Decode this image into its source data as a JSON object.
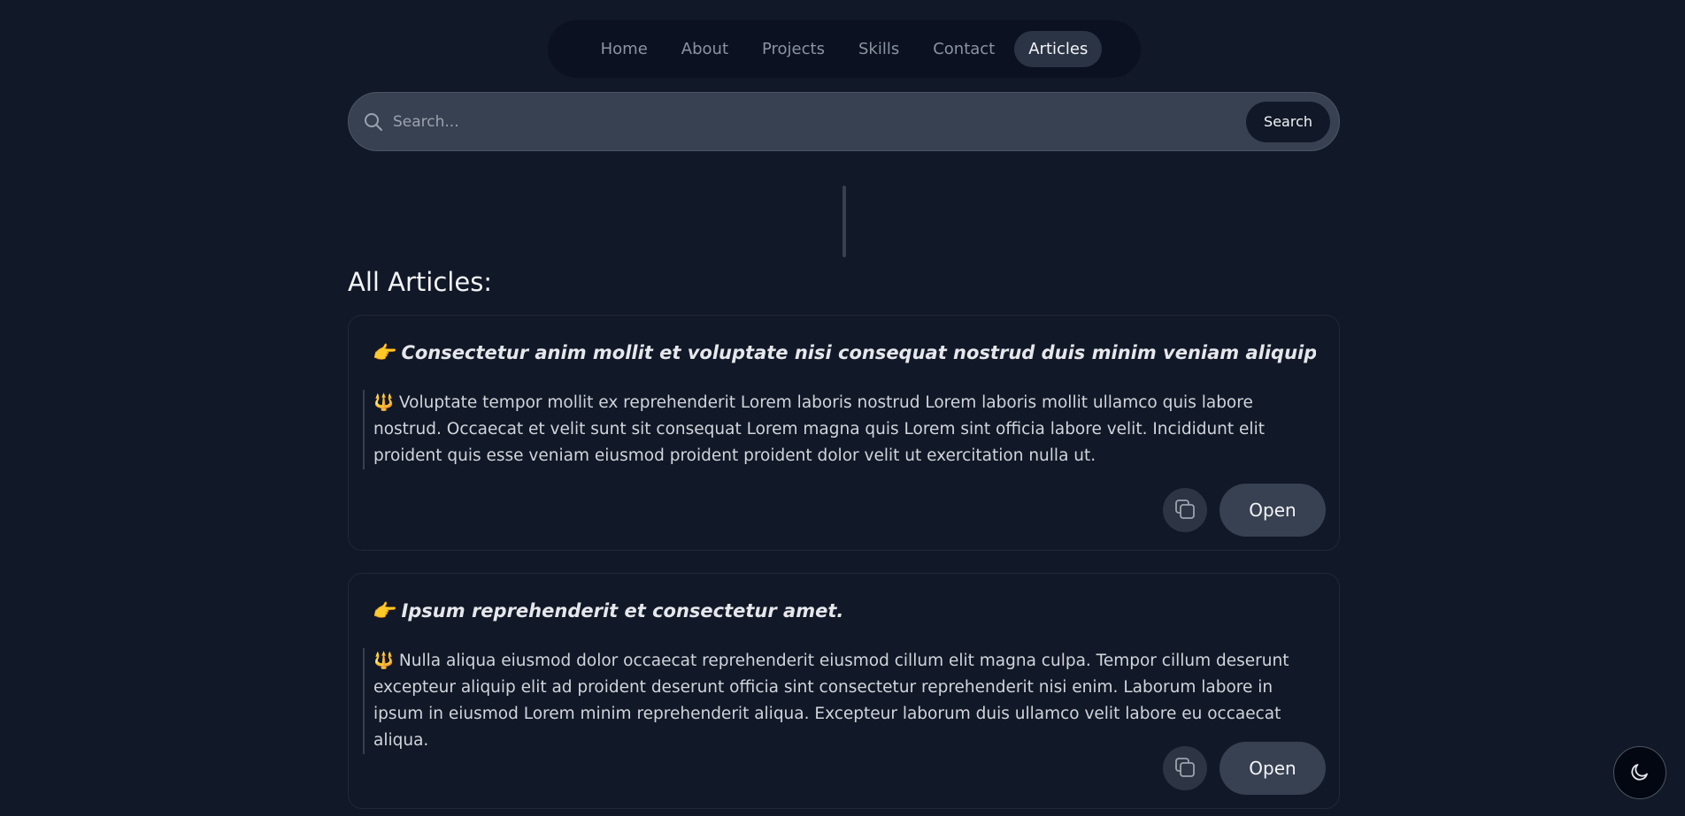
{
  "nav": {
    "items": [
      {
        "label": "Home"
      },
      {
        "label": "About"
      },
      {
        "label": "Projects"
      },
      {
        "label": "Skills"
      },
      {
        "label": "Contact"
      },
      {
        "label": "Articles",
        "active": true
      }
    ]
  },
  "search": {
    "placeholder": "Search...",
    "value": "",
    "button_label": "Search"
  },
  "section": {
    "title": "All Articles:"
  },
  "articles": [
    {
      "title": "👉 Consectetur anim mollit et voluptate nisi consequat nostrud duis minim veniam aliquip consequat.",
      "summary": "🔱 Voluptate tempor mollit ex reprehenderit Lorem laboris nostrud Lorem laboris mollit ullamco quis labore nostrud. Occaecat et velit sunt sit consequat Lorem magna quis Lorem sint officia labore velit. Incididunt elit proident quis esse veniam eiusmod proident proident dolor velit ut exercitation nulla ut.",
      "open_label": "Open"
    },
    {
      "title": "👉 Ipsum reprehenderit et consectetur amet.",
      "summary": "🔱 Nulla aliqua eiusmod dolor occaecat reprehenderit eiusmod cillum elit magna culpa. Tempor cillum deserunt excepteur aliquip elit ad proident deserunt officia sint consectetur reprehenderit nisi enim. Laborum labore in ipsum in eiusmod Lorem minim reprehenderit aliqua. Excepteur laborum duis ullamco velit labore eu occaecat aliqua.",
      "open_label": "Open"
    }
  ],
  "icons": {
    "search": "search-icon",
    "copy": "copy-icon",
    "theme": "moon-icon"
  },
  "colors": {
    "background": "#111827",
    "surface": "#374151",
    "nav_background": "#0b1120",
    "active_nav": "#2b3444"
  }
}
